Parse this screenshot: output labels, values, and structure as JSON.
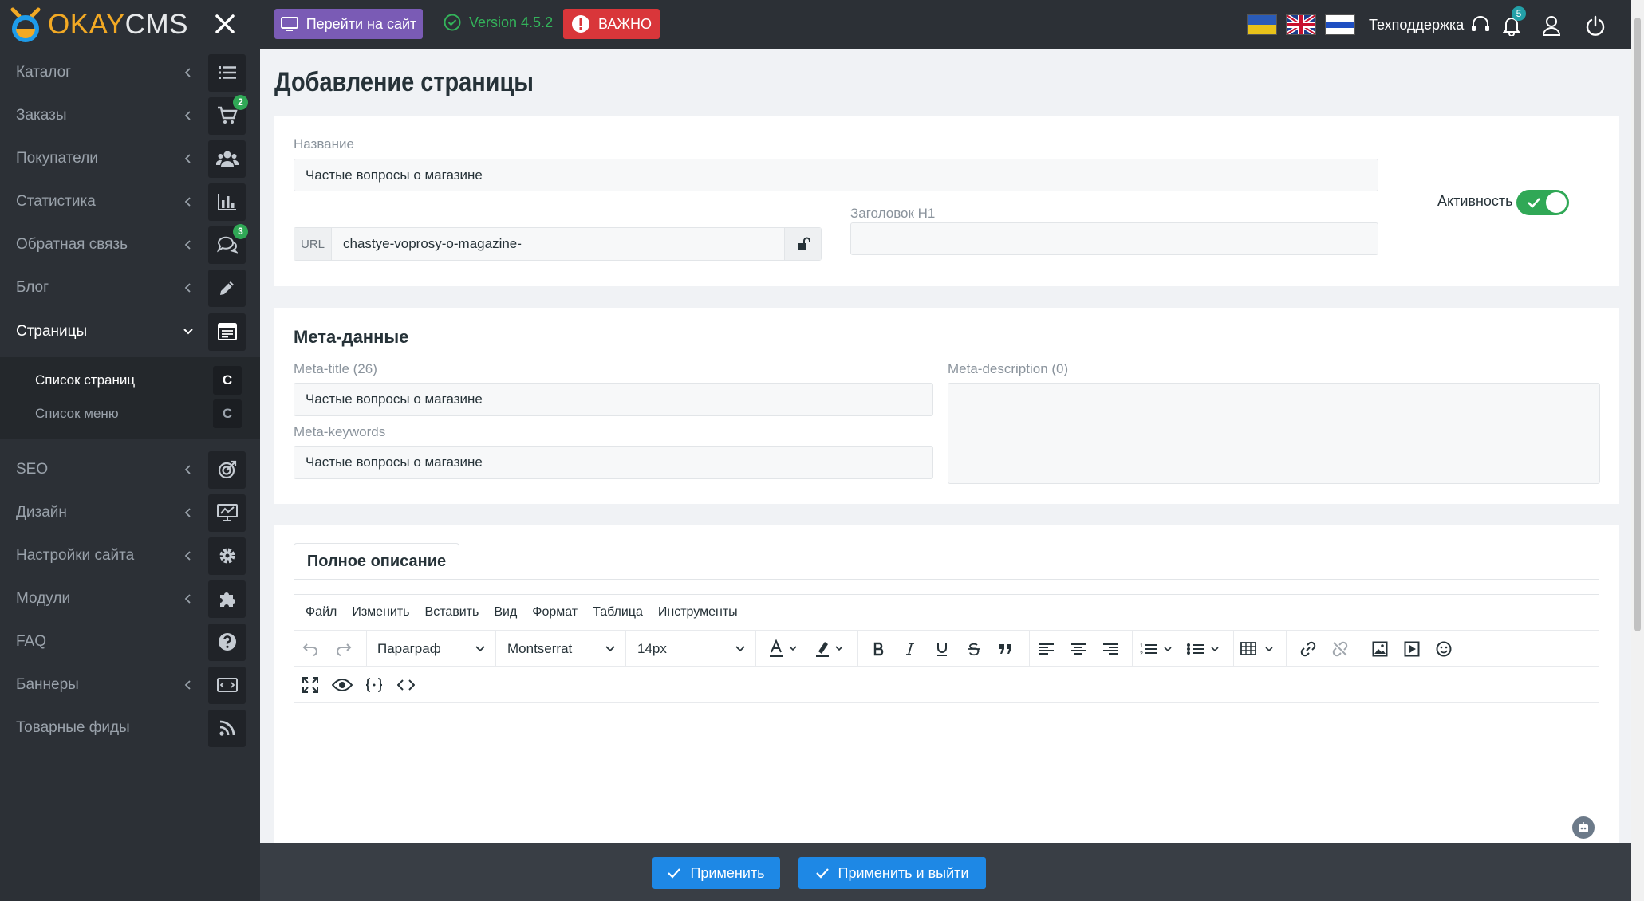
{
  "brand": {
    "okay": "OKAY",
    "cms": "CMS"
  },
  "sidebar": {
    "items": [
      {
        "label": "Каталог",
        "icon": "list-icon",
        "badge": null,
        "chevron": "left"
      },
      {
        "label": "Заказы",
        "icon": "cart-icon",
        "badge": "2",
        "chevron": "left"
      },
      {
        "label": "Покупатели",
        "icon": "users-icon",
        "badge": null,
        "chevron": "left"
      },
      {
        "label": "Статистика",
        "icon": "bar-chart-icon",
        "badge": null,
        "chevron": "left"
      },
      {
        "label": "Обратная связь",
        "icon": "comments-icon",
        "badge": "3",
        "chevron": "left"
      },
      {
        "label": "Блог",
        "icon": "pencil-icon",
        "badge": null,
        "chevron": "left"
      },
      {
        "label": "Страницы",
        "icon": "page-icon",
        "badge": null,
        "chevron": "down",
        "active": true
      },
      {
        "label": "SEO",
        "icon": "target-icon",
        "badge": null,
        "chevron": "left"
      },
      {
        "label": "Дизайн",
        "icon": "monitor-icon",
        "badge": null,
        "chevron": "left"
      },
      {
        "label": "Настройки сайта",
        "icon": "gear-icon",
        "badge": null,
        "chevron": "left"
      },
      {
        "label": "Модули",
        "icon": "puzzle-icon",
        "badge": null,
        "chevron": "left"
      },
      {
        "label": "FAQ",
        "icon": "question-icon",
        "badge": null,
        "chevron": null
      },
      {
        "label": "Баннеры",
        "icon": "banner-icon",
        "badge": null,
        "chevron": "left"
      },
      {
        "label": "Товарные фиды",
        "icon": "rss-icon",
        "badge": null,
        "chevron": null
      }
    ],
    "subitems": [
      {
        "label": "Список страниц",
        "box": "C",
        "active": true
      },
      {
        "label": "Список меню",
        "box": "C",
        "active": false
      }
    ]
  },
  "topbar": {
    "site_button": "Перейти на сайт",
    "version": "Version 4.5.2",
    "important": "ВАЖНО",
    "languages": [
      "ua-flag",
      "uk-flag",
      "ru-flag"
    ],
    "support": "Техподдержка",
    "notifications": "5"
  },
  "page": {
    "title": "Добавление страницы",
    "name_label": "Название",
    "name_value": "Частые вопросы о магазине",
    "url_prefix": "URL",
    "url_value": "chastye-voprosy-o-magazine-",
    "h1_label": "Заголовок H1",
    "h1_value": "",
    "activity_label": "Активность",
    "activity_on": true
  },
  "meta": {
    "heading": "Мета-данные",
    "title_label": "Meta-title (26)",
    "title_value": "Частые вопросы о магазине",
    "keywords_label": "Meta-keywords",
    "keywords_value": "Частые вопросы о магазине",
    "description_label": "Meta-description (0)",
    "description_value": ""
  },
  "editor": {
    "tab": "Полное описание",
    "menu": [
      "Файл",
      "Изменить",
      "Вставить",
      "Вид",
      "Формат",
      "Таблица",
      "Инструменты"
    ],
    "block_format": "Параграф",
    "font_family": "Montserrat",
    "font_size": "14px"
  },
  "footer": {
    "apply": "Применить",
    "apply_exit": "Применить и выйти"
  },
  "colors": {
    "sidebar_bg": "#2c3036",
    "accent_blue": "#1e88e5",
    "success_green": "#30a856",
    "danger_red": "#d9363a",
    "purple": "#7a5bb5",
    "brand_orange": "#f2a924"
  }
}
